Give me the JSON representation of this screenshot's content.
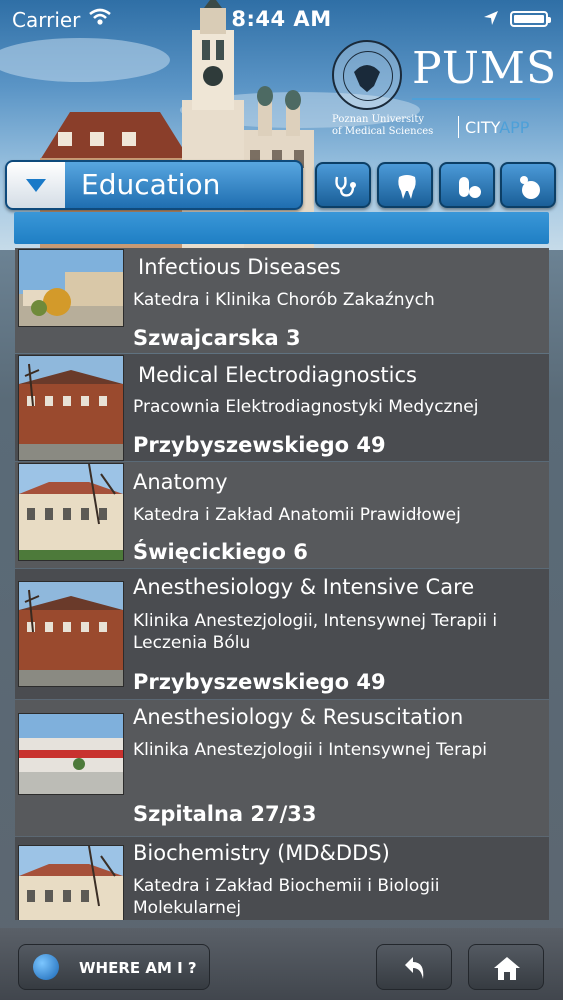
{
  "status_bar": {
    "carrier": "Carrier",
    "time": "8:44 AM"
  },
  "logo": {
    "brand": "PUMS",
    "university_line1": "Poznan University",
    "university_line2": "of Medical Sciences",
    "city": "CITY",
    "app": "APP"
  },
  "category": {
    "selected": "Education",
    "icons": [
      "stethoscope-icon",
      "tooth-icon",
      "pill-icon",
      "medicine-drop-icon"
    ]
  },
  "list": {
    "items": [
      {
        "title": "Infectious Diseases",
        "subtitle": "Katedra i Klinika Chorób Zakaźnych",
        "address": "Szwajcarska 3"
      },
      {
        "title": "Medical Electrodiagnostics",
        "subtitle": "Pracownia Elektrodiagnostyki Medycznej",
        "address": "Przybyszewskiego 49"
      },
      {
        "title": "Anatomy",
        "subtitle": "Katedra i Zakład Anatomii Prawidłowej",
        "address": "Święcickiego 6"
      },
      {
        "title": "Anesthesiology & Intensive Care",
        "subtitle": "Klinika Anestezjologii, Intensywnej Terapii i Leczenia Bólu",
        "address": "Przybyszewskiego 49"
      },
      {
        "title": "Anesthesiology & Resuscitation",
        "subtitle": "Klinika Anestezjologii i Intensywnej Terapi",
        "address": "Szpitalna 27/33"
      },
      {
        "title": "Biochemistry (MD&DDS)",
        "subtitle": "Katedra i Zakład Biochemii i Biologii Molekularnej",
        "address": ""
      }
    ]
  },
  "toolbar": {
    "where_am_i": "WHERE AM I ?",
    "back_icon": "back-arrow-icon",
    "home_icon": "home-icon"
  },
  "colors": {
    "accent": "#2a86cc",
    "list_bg": "#57595c",
    "toolbar_bg": "#4b5057"
  }
}
